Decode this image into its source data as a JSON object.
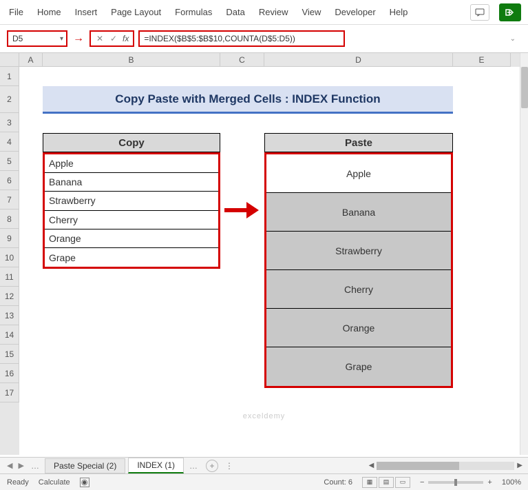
{
  "ribbon": {
    "items": [
      "File",
      "Home",
      "Insert",
      "Page Layout",
      "Formulas",
      "Data",
      "Review",
      "View",
      "Developer",
      "Help"
    ]
  },
  "formula_bar": {
    "cell_ref": "D5",
    "formula": "=INDEX($B$5:$B$10,COUNTA(D$5:D5))"
  },
  "columns": [
    "A",
    "B",
    "C",
    "D",
    "E"
  ],
  "rows": [
    "1",
    "2",
    "3",
    "4",
    "5",
    "6",
    "7",
    "8",
    "9",
    "10",
    "11",
    "12",
    "13",
    "14",
    "15",
    "16",
    "17"
  ],
  "title": "Copy Paste with Merged Cells : INDEX Function",
  "headers": {
    "copy": "Copy",
    "paste": "Paste"
  },
  "copy_items": [
    "Apple",
    "Banana",
    "Strawberry",
    "Cherry",
    "Orange",
    "Grape"
  ],
  "paste_items": [
    "Apple",
    "Banana",
    "Strawberry",
    "Cherry",
    "Orange",
    "Grape"
  ],
  "tabs": {
    "inactive": "Paste Special (2)",
    "active": "INDEX (1)"
  },
  "status": {
    "ready": "Ready",
    "calc": "Calculate",
    "count": "Count: 6",
    "zoom": "100%"
  },
  "watermark": "exceldemy"
}
